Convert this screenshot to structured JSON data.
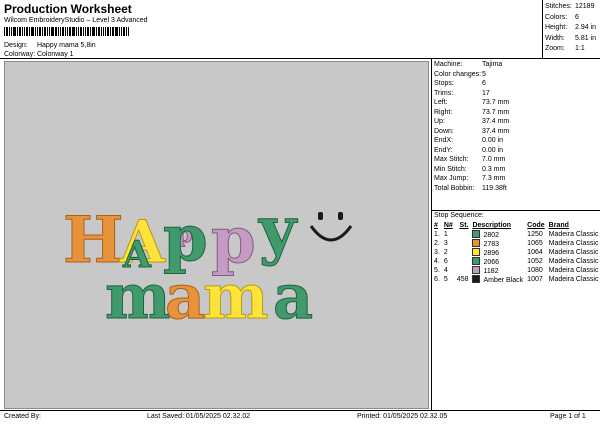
{
  "header": {
    "title": "Production Worksheet",
    "software": "Wilcom EmbroideryStudio – Level 3 Advanced",
    "design_label": "Design:",
    "design_value": "Happy mama 5,8in",
    "colorway_label": "Colorway:",
    "colorway_value": "Colonway 1"
  },
  "top_stats": [
    {
      "label": "Stitches:",
      "value": "12189"
    },
    {
      "label": "Colors:",
      "value": "6"
    },
    {
      "label": "Height:",
      "value": "2.94 in"
    },
    {
      "label": "Width:",
      "value": "5.81 in"
    },
    {
      "label": "Zoom:",
      "value": "1:1"
    }
  ],
  "design": {
    "word1": [
      "H",
      "A",
      "p",
      "p",
      "y"
    ],
    "word2": [
      "m",
      "a",
      "m",
      "a"
    ],
    "small_a": "A",
    "small_letters": [
      "p",
      "p"
    ],
    "smiley": "⌣",
    "colors": {
      "green": "#3f9a6c",
      "orange": "#e8923a",
      "yellow": "#ffe23a",
      "pink": "#c59ac3",
      "dark": "#1a1a1a"
    }
  },
  "specs": [
    {
      "label": "Machine:",
      "value": "Tajima"
    },
    {
      "label": "Color changes:",
      "value": "5"
    },
    {
      "label": "Stops:",
      "value": "6"
    },
    {
      "label": "Trims:",
      "value": "17"
    },
    {
      "label": "Left:",
      "value": "73.7 mm"
    },
    {
      "label": "Right:",
      "value": "73.7 mm"
    },
    {
      "label": "Up:",
      "value": "37.4 mm"
    },
    {
      "label": "Down:",
      "value": "37.4 mm"
    },
    {
      "label": "EndX:",
      "value": "0.00 in"
    },
    {
      "label": "EndY:",
      "value": "0.00 in"
    },
    {
      "label": "Max Stitch:",
      "value": "7.0 mm"
    },
    {
      "label": "Min Stitch:",
      "value": "0.3 mm"
    },
    {
      "label": "Max Jump:",
      "value": "7.3 mm"
    },
    {
      "label": "Total Bobbin:",
      "value": "119.38ft"
    }
  ],
  "stop_sequence": {
    "title": "Stop Sequence:",
    "headers": [
      "#",
      "N#",
      "St.",
      "Description",
      "Code",
      "Brand"
    ],
    "rows": [
      {
        "idx": "1.",
        "n": "1",
        "color": "#3f9a6c",
        "st": "",
        "desc": "2802",
        "code": "1250",
        "brand": "Madeira Classic 40"
      },
      {
        "idx": "2.",
        "n": "3",
        "color": "#e8923a",
        "st": "",
        "desc": "2783",
        "code": "1065",
        "brand": "Madeira Classic 40"
      },
      {
        "idx": "3.",
        "n": "2",
        "color": "#ffe23a",
        "st": "",
        "desc": "2896",
        "code": "1064",
        "brand": "Madeira Classic 40"
      },
      {
        "idx": "4.",
        "n": "6",
        "color": "#3f9a6c",
        "st": "",
        "desc": "2066",
        "code": "1052",
        "brand": "Madeira Classic 40"
      },
      {
        "idx": "5.",
        "n": "4",
        "color": "#c59ac3",
        "st": "",
        "desc": "1182",
        "code": "1080",
        "brand": "Madeira Classic 40"
      },
      {
        "idx": "6.",
        "n": "5",
        "color": "#1a1a1a",
        "st": "458",
        "desc": "Amber Black",
        "code": "1007",
        "brand": "Madeira Classic 40"
      }
    ]
  },
  "footer": {
    "created": "Created By:",
    "saved": "Last Saved: 01/05/2025 02.32.02",
    "printed": "Printed: 01/05/2025 02.32.05",
    "page": "Page 1 of 1"
  }
}
